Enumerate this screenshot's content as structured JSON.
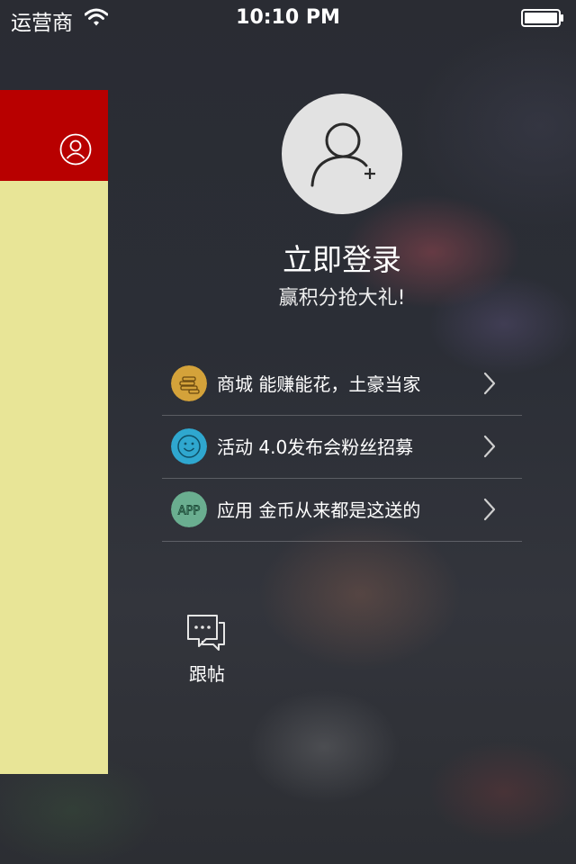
{
  "status_bar": {
    "carrier": "运营商",
    "time": "10:10 PM"
  },
  "login": {
    "title": "立即登录",
    "subtitle": "赢积分抢大礼!"
  },
  "menu": [
    {
      "label": "商城 能赚能花，土豪当家",
      "icon": "coins-icon",
      "color": "#d4a23a"
    },
    {
      "label": "活动 4.0发布会粉丝招募",
      "icon": "smiley-icon",
      "color": "#2fa7cf"
    },
    {
      "label": "应用 金币从来都是这送的",
      "icon": "app-icon",
      "color": "#6aae90"
    }
  ],
  "reply": {
    "label": "跟帖",
    "icon": "comment-icon"
  },
  "colors": {
    "header_red": "#b80000",
    "panel_yellow": "#e8e597"
  }
}
